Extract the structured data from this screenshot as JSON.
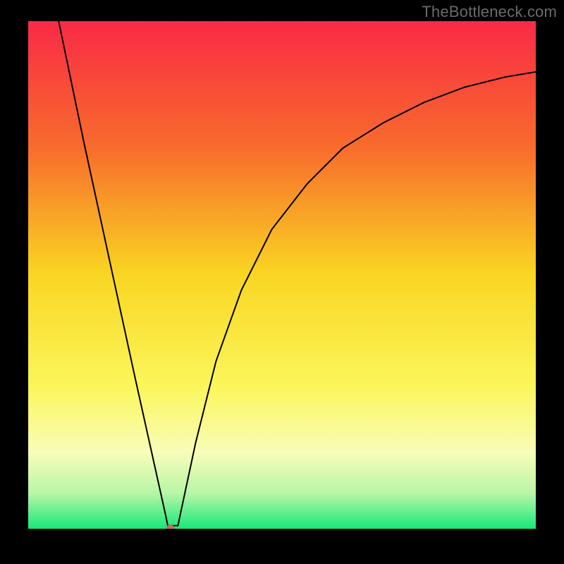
{
  "watermark": "TheBottleneck.com",
  "chart_data": {
    "type": "line",
    "title": "",
    "xlabel": "",
    "ylabel": "",
    "xlim": [
      0,
      100
    ],
    "ylim": [
      0,
      100
    ],
    "legend": false,
    "grid": false,
    "background_gradient": {
      "stops": [
        {
          "offset": 0,
          "color": "#f92a46"
        },
        {
          "offset": 25,
          "color": "#f86c2c"
        },
        {
          "offset": 50,
          "color": "#f9d622"
        },
        {
          "offset": 72,
          "color": "#fbf65b"
        },
        {
          "offset": 85,
          "color": "#f8fdba"
        },
        {
          "offset": 93,
          "color": "#b8f6a6"
        },
        {
          "offset": 100,
          "color": "#17e87a"
        }
      ]
    },
    "marker": {
      "x": 28,
      "y": 0,
      "color": "#c96a5b",
      "radius_px": 6
    },
    "series": [
      {
        "name": "curve",
        "stroke": "#000000",
        "stroke_width": 2,
        "points": [
          {
            "x": 6,
            "y": 100
          },
          {
            "x": 11,
            "y": 76
          },
          {
            "x": 16,
            "y": 53
          },
          {
            "x": 21,
            "y": 30
          },
          {
            "x": 25,
            "y": 12
          },
          {
            "x": 27,
            "y": 3
          },
          {
            "x": 27.5,
            "y": 0.6
          },
          {
            "x": 29.5,
            "y": 0.6
          },
          {
            "x": 30,
            "y": 3
          },
          {
            "x": 33,
            "y": 17
          },
          {
            "x": 37,
            "y": 33
          },
          {
            "x": 42,
            "y": 47
          },
          {
            "x": 48,
            "y": 59
          },
          {
            "x": 55,
            "y": 68
          },
          {
            "x": 62,
            "y": 75
          },
          {
            "x": 70,
            "y": 80
          },
          {
            "x": 78,
            "y": 84
          },
          {
            "x": 86,
            "y": 87
          },
          {
            "x": 94,
            "y": 89
          },
          {
            "x": 100,
            "y": 90
          }
        ]
      }
    ]
  }
}
